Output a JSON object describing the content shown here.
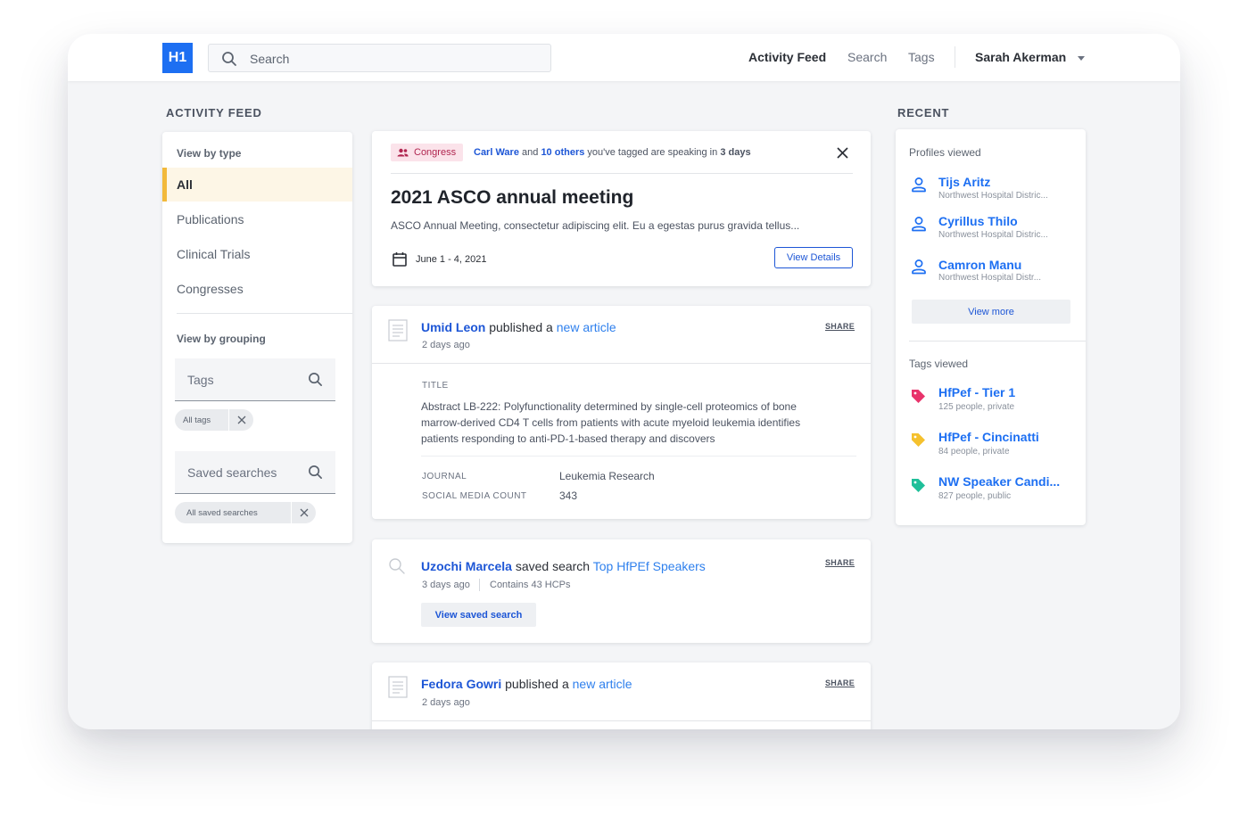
{
  "header": {
    "logo": "H1",
    "search_placeholder": "Search",
    "nav": [
      "Activity Feed",
      "Search",
      "Tags"
    ],
    "user_name": "Sarah Akerman"
  },
  "left": {
    "section_title": "ACTIVITY FEED",
    "view_by_type_label": "View by type",
    "types": [
      "All",
      "Publications",
      "Clinical Trials",
      "Congresses"
    ],
    "view_by_grouping_label": "View by grouping",
    "tags_placeholder": "Tags",
    "tags_chip": "All tags",
    "saved_placeholder": "Saved searches",
    "saved_chip": "All saved searches"
  },
  "congress": {
    "badge": "Congress",
    "person": "Carl Ware",
    "and": "and",
    "others": "10 others",
    "rest": "you've tagged are speaking in",
    "when": "3 days",
    "title": "2021 ASCO annual meeting",
    "description": "ASCO Annual Meeting, consectetur adipiscing elit. Eu a egestas purus gravida tellus...",
    "date": "June 1 - 4, 2021",
    "button": "View Details"
  },
  "post1": {
    "who": "Umid Leon",
    "verb": "published a",
    "what": "new article",
    "time": "2 days ago",
    "share": "SHARE",
    "title_label": "TITLE",
    "title_lines": [
      "Abstract LB-222: Polyfunctionality determined by single-cell proteomics of bone",
      "marrow-derived CD4 T cells from patients with acute myeloid leukemia identifies",
      "patients responding to anti-PD-1-based therapy and discovers"
    ],
    "journal_label": "JOURNAL",
    "journal_value": "Leukemia Research",
    "social_label": "SOCIAL MEDIA COUNT",
    "social_value": "343"
  },
  "post2": {
    "who": "Uzochi Marcela",
    "verb": "saved search",
    "what": "Top HfPEf Speakers",
    "time": "3 days ago",
    "contains": "Contains 43 HCPs",
    "share": "SHARE",
    "button": "View saved search"
  },
  "post3": {
    "who": "Fedora Gowri",
    "verb": "published a",
    "what": "new article",
    "time": "2 days ago",
    "share": "SHARE"
  },
  "recent": {
    "section_title": "RECENT",
    "profiles_label": "Profiles viewed",
    "profiles": [
      {
        "name": "Tijs Aritz",
        "sub": "Northwest Hospital Distric..."
      },
      {
        "name": "Cyrillus Thilo",
        "sub": "Northwest Hospital Distric..."
      },
      {
        "name": "Camron Manu",
        "sub": "Northwest Hospital Distr..."
      }
    ],
    "view_more": "View more",
    "tags_label": "Tags viewed",
    "tags": [
      {
        "name": "HfPef - Tier 1",
        "sub": "125 people, private",
        "color": "#e8336b"
      },
      {
        "name": "HfPef - Cincinatti",
        "sub": "84 people, private",
        "color": "#f5c12e"
      },
      {
        "name": "NW Speaker Candi...",
        "sub": "827 people, public",
        "color": "#1fbf9a"
      }
    ]
  },
  "colors": {
    "brand": "#1d6ff2",
    "link": "#1d56d6",
    "active_accent": "#f2b93b",
    "badge_bg": "#fbe3ea",
    "badge_text": "#b0254f"
  }
}
